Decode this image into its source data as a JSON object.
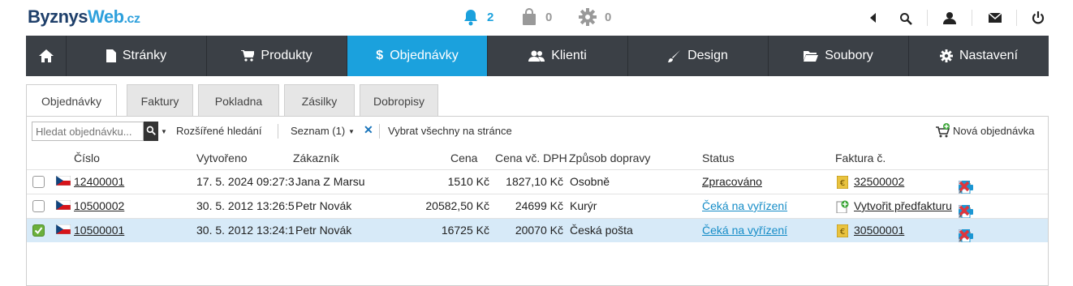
{
  "logo": {
    "part1": "Byznys",
    "part2": "Web",
    "part3": ".cz"
  },
  "notifications": {
    "alerts": "2",
    "orders": "0",
    "tasks": "0"
  },
  "nav": {
    "items": [
      "Stránky",
      "Produkty",
      "Objednávky",
      "Klienti",
      "Design",
      "Soubory",
      "Nastavení"
    ],
    "active_index": 2
  },
  "tabs": [
    "Objednávky",
    "Faktury",
    "Pokladna",
    "Zásilky",
    "Dobropisy"
  ],
  "toolbar": {
    "search_placeholder": "Hledat objednávku...",
    "advanced_search": "Rozšířené hledání",
    "list_selector": "Seznam (1)",
    "select_all": "Vybrat všechny na stránce",
    "new_order": "Nová objednávka"
  },
  "table": {
    "columns": [
      "Číslo",
      "Vytvořeno",
      "Zákazník",
      "Cena",
      "Cena vč. DPH",
      "Způsob dopravy",
      "Status",
      "Faktura č."
    ],
    "rows": [
      {
        "number": "12400001",
        "created": "17. 5. 2024 09:27:3",
        "customer": "Jana Z Marsu",
        "price": "1510 Kč",
        "price_vat": "1827,10 Kč",
        "shipping": "Osobně",
        "status": "Zpracováno",
        "invoice": "32500002",
        "invoice_type": "euro",
        "selected": false
      },
      {
        "number": "10500002",
        "created": "30. 5. 2012 13:26:5",
        "customer": "Petr Novák",
        "price": "20582,50 Kč",
        "price_vat": "24699 Kč",
        "shipping": "Kurýr",
        "status": "Čeká na vyřízení",
        "invoice": "Vytvořit předfakturu",
        "invoice_type": "create",
        "selected": false
      },
      {
        "number": "10500001",
        "created": "30. 5. 2012 13:24:1",
        "customer": "Petr Novák",
        "price": "16725 Kč",
        "price_vat": "20070 Kč",
        "shipping": "Česká pošta",
        "status": "Čeká na vyřízení",
        "invoice": "30500001",
        "invoice_type": "euro",
        "selected": true
      }
    ]
  },
  "colors": {
    "nav_bg": "#3b4046",
    "active": "#1ba1dd",
    "selected_row": "#d7eaf8",
    "delete": "#e0353c"
  }
}
